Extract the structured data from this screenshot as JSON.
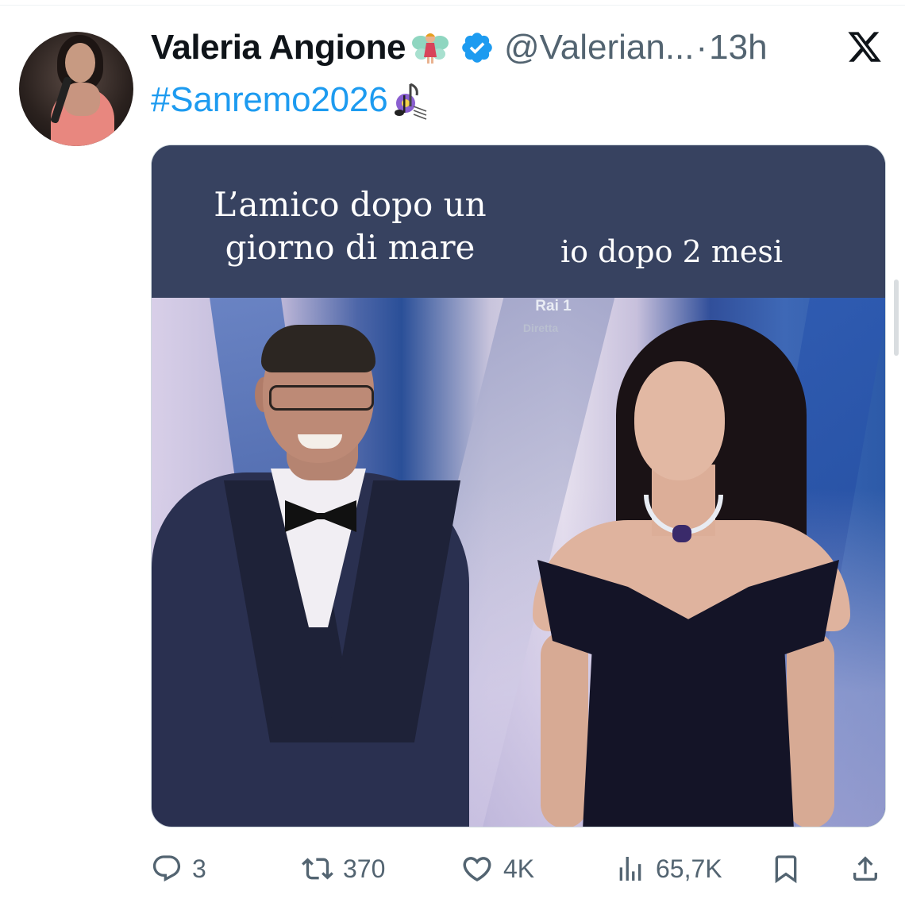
{
  "tweet": {
    "author": {
      "display_name": "Valeria Angione",
      "name_emoji": "fairy-icon",
      "verified": true,
      "handle": "@Valerian...",
      "separator": "·",
      "time": "13h"
    },
    "text": {
      "hashtag": "#Sanremo2026",
      "trailing_emoji": "music-notes-icon"
    },
    "media": {
      "caption_left": "L’amico dopo un giorno di mare",
      "caption_right": "io dopo 2 mesi",
      "broadcaster_logo": "Rai 1",
      "broadcast_status": "Diretta"
    },
    "actions": {
      "reply_count": "3",
      "retweet_count": "370",
      "like_count": "4K",
      "views_count": "65,7K"
    }
  },
  "colors": {
    "link": "#1d9bf0",
    "secondary_text": "#536471",
    "primary_text": "#0f1419",
    "verified": "#1d9bf0",
    "caption_band": "#374260"
  }
}
